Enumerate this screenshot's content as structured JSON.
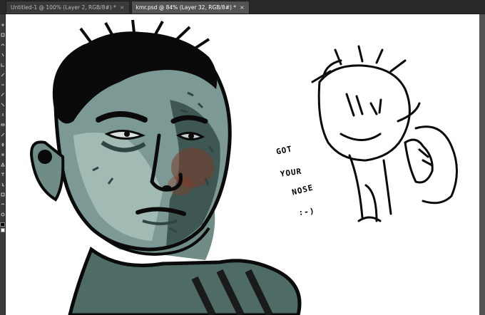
{
  "tabs": [
    {
      "label": "Untitled-1 @ 100% (Layer 2, RGB/8#) *",
      "close_label": "×",
      "active": false
    },
    {
      "label": "kmr.psd @ 84% (Layer 32, RGB/8#) *",
      "close_label": "×",
      "active": true
    }
  ],
  "toolbar": {
    "tools": [
      "move-tool",
      "marquee-tool",
      "lasso-tool",
      "quick-select-tool",
      "crop-tool",
      "eyedropper-tool",
      "healing-tool",
      "brush-tool",
      "clone-stamp-tool",
      "history-brush-tool",
      "eraser-tool",
      "gradient-tool",
      "blur-tool",
      "dodge-tool",
      "pen-tool",
      "type-tool",
      "path-select-tool",
      "shape-tool",
      "hand-tool",
      "zoom-tool"
    ],
    "foreground_color": "#000000",
    "background_color": "#ffffff"
  },
  "canvas": {
    "handwriting": [
      "GOT",
      "YOUR",
      "NOSE",
      ":-)"
    ],
    "palette": {
      "skin_dark": "#4f6b66",
      "skin_mid": "#7d9995",
      "skin_light": "#a8bfba",
      "shadow": "#2e4541",
      "blush": "#7a3a2a",
      "ink": "#0a0a0a"
    }
  }
}
